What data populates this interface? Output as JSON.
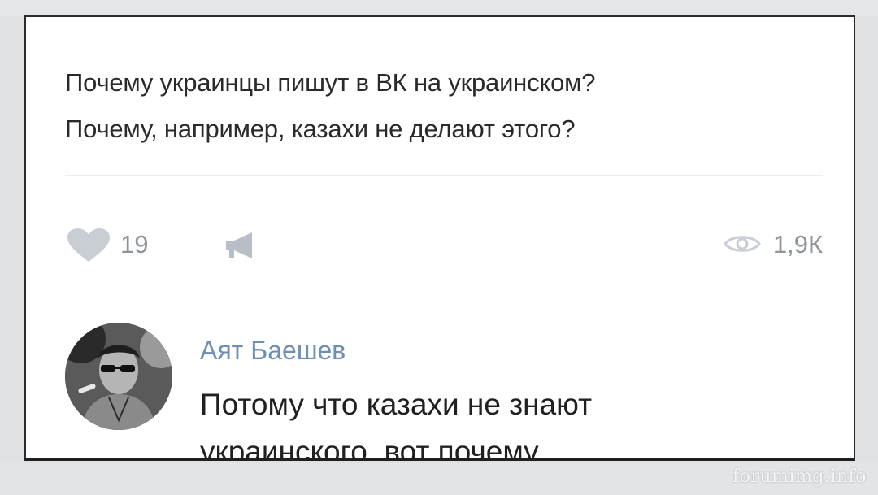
{
  "post": {
    "text_lines": [
      "Почему украинцы пишут в ВК на украинском?",
      "Почему, например, казахи не делают этого?"
    ],
    "likes": "19",
    "views": "1,9К"
  },
  "comment": {
    "author": "Аят Баешев",
    "text_lines": [
      "Потому что казахи не знают",
      "украинского, вот почему"
    ]
  },
  "watermark": "forumimg.info",
  "icons": {
    "like": "heart-icon",
    "share": "megaphone-icon",
    "views": "eye-icon"
  },
  "colors": {
    "author_link": "#6d8fb3",
    "meta_gray": "#8f959b",
    "icon_gray": "#c9ced4"
  }
}
